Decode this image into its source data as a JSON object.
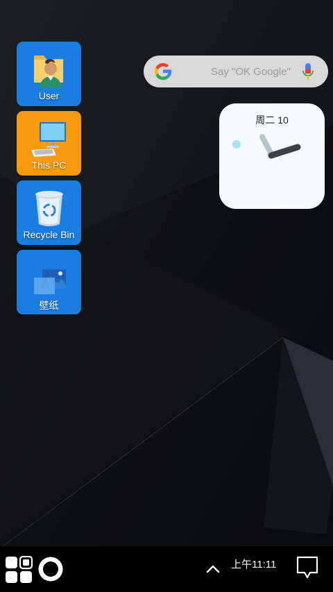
{
  "desktop": {
    "icons": [
      {
        "label": "User",
        "icon": "user-folder-icon",
        "bg": "#1a7de0"
      },
      {
        "label": "This PC",
        "icon": "computer-icon",
        "bg": "#f59a0c"
      },
      {
        "label": "Recycle Bin",
        "icon": "recycle-bin-icon",
        "bg": "#1a7de0"
      },
      {
        "label": "壁纸",
        "icon": "wallpaper-icon",
        "bg": "#1a7de0"
      }
    ]
  },
  "search_widget": {
    "placeholder": "Say \"OK Google\"",
    "logo": "google-g-icon",
    "mic": "microphone-icon"
  },
  "clock_widget": {
    "date": "周二 10",
    "hour_hand_color": "#3c4148",
    "minute_hand_color": "#b7c4cc",
    "dot_color": "#a6e3ef"
  },
  "taskbar": {
    "start_icon": "start-menu-icon",
    "home_icon": "circle-home-icon",
    "tray_icon": "chevron-up-icon",
    "time": "上午11:11",
    "notification_icon": "notification-icon"
  }
}
